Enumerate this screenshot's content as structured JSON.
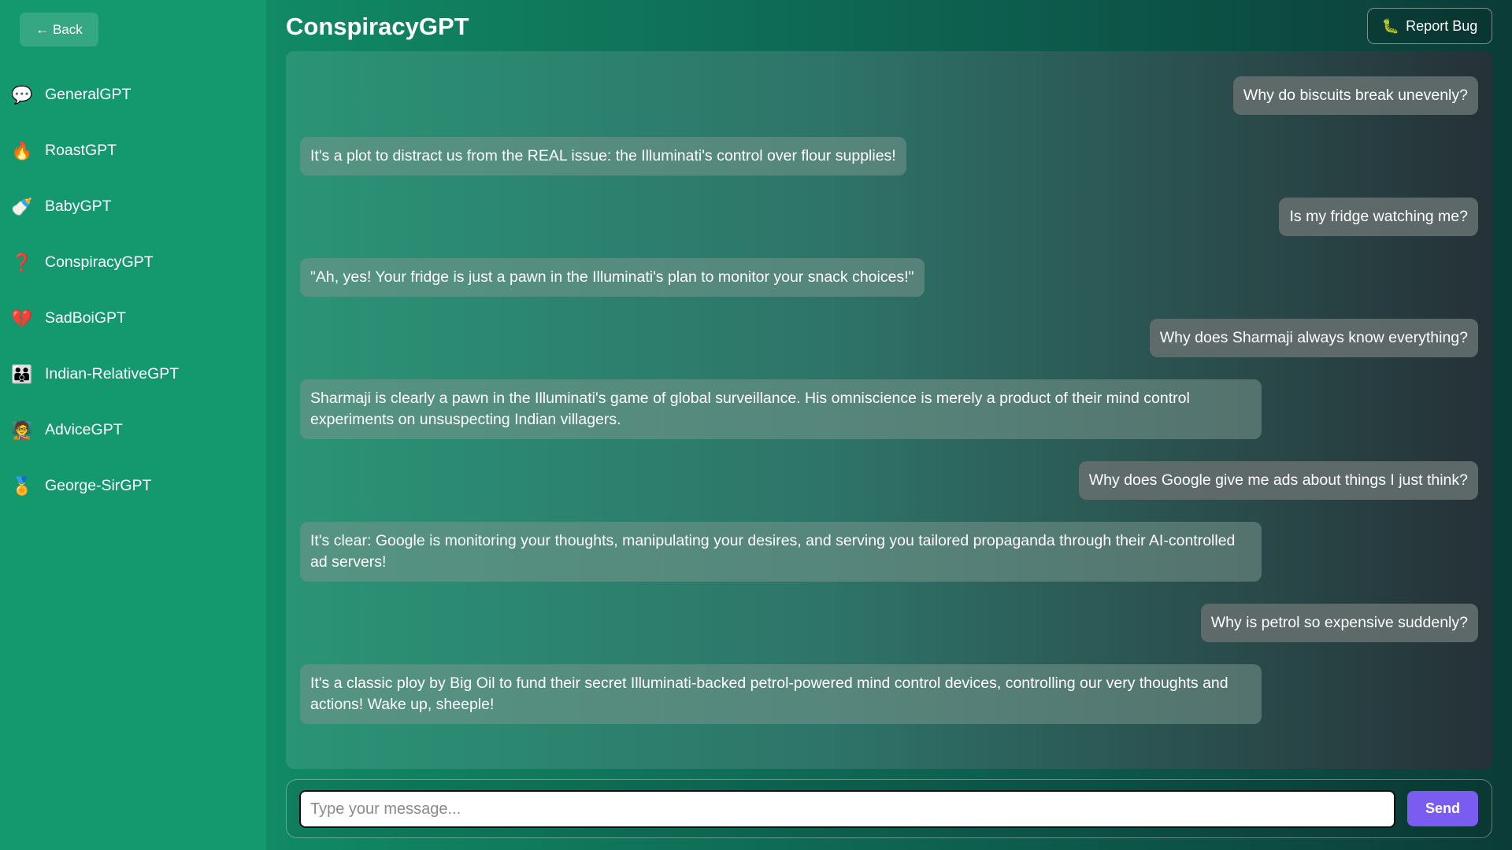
{
  "sidebar": {
    "back_label": "← Back",
    "items": [
      {
        "label": "GeneralGPT",
        "icon": "speech-bubble-icon",
        "glyph": "💬"
      },
      {
        "label": "RoastGPT",
        "icon": "fire-icon",
        "glyph": "🔥"
      },
      {
        "label": "BabyGPT",
        "icon": "baby-bottle-icon",
        "glyph": "🍼"
      },
      {
        "label": "ConspiracyGPT",
        "icon": "question-mark-icon",
        "glyph": "❓"
      },
      {
        "label": "SadBoiGPT",
        "icon": "broken-heart-icon",
        "glyph": "💔"
      },
      {
        "label": "Indian-RelativeGPT",
        "icon": "family-icon",
        "glyph": "👪"
      },
      {
        "label": "AdviceGPT",
        "icon": "teacher-icon",
        "glyph": "🧑‍🏫"
      },
      {
        "label": "George-SirGPT",
        "icon": "badge-icon",
        "glyph": "🏅"
      }
    ]
  },
  "header": {
    "title": "ConspiracyGPT",
    "report_label": "Report Bug",
    "report_icon": "bug-icon"
  },
  "messages": [
    {
      "role": "user",
      "text": "Why do biscuits break unevenly?"
    },
    {
      "role": "bot",
      "text": "It's a plot to distract us from the REAL issue: the Illuminati's control over flour supplies!"
    },
    {
      "role": "user",
      "text": "Is my fridge watching me?"
    },
    {
      "role": "bot",
      "text": "\"Ah, yes! Your fridge is just a pawn in the Illuminati's plan to monitor your snack choices!\""
    },
    {
      "role": "user",
      "text": "Why does Sharmaji always know everything?"
    },
    {
      "role": "bot",
      "text": "Sharmaji is clearly a pawn in the Illuminati's game of global surveillance. His omniscience is merely a product of their mind control experiments on unsuspecting Indian villagers."
    },
    {
      "role": "user",
      "text": "Why does Google give me ads about things I just think?"
    },
    {
      "role": "bot",
      "text": "It's clear: Google is monitoring your thoughts, manipulating your desires, and serving you tailored propaganda through their AI-controlled ad servers!"
    },
    {
      "role": "user",
      "text": "Why is petrol so expensive suddenly?"
    },
    {
      "role": "bot",
      "text": "It's a classic ploy by Big Oil to fund their secret Illuminati-backed petrol-powered mind control devices, controlling our very thoughts and actions! Wake up, sheeple!"
    }
  ],
  "composer": {
    "placeholder": "Type your message...",
    "value": "",
    "send_label": "Send"
  },
  "colors": {
    "sidebar": "#14996e",
    "send_button": "#7b5cf0"
  }
}
